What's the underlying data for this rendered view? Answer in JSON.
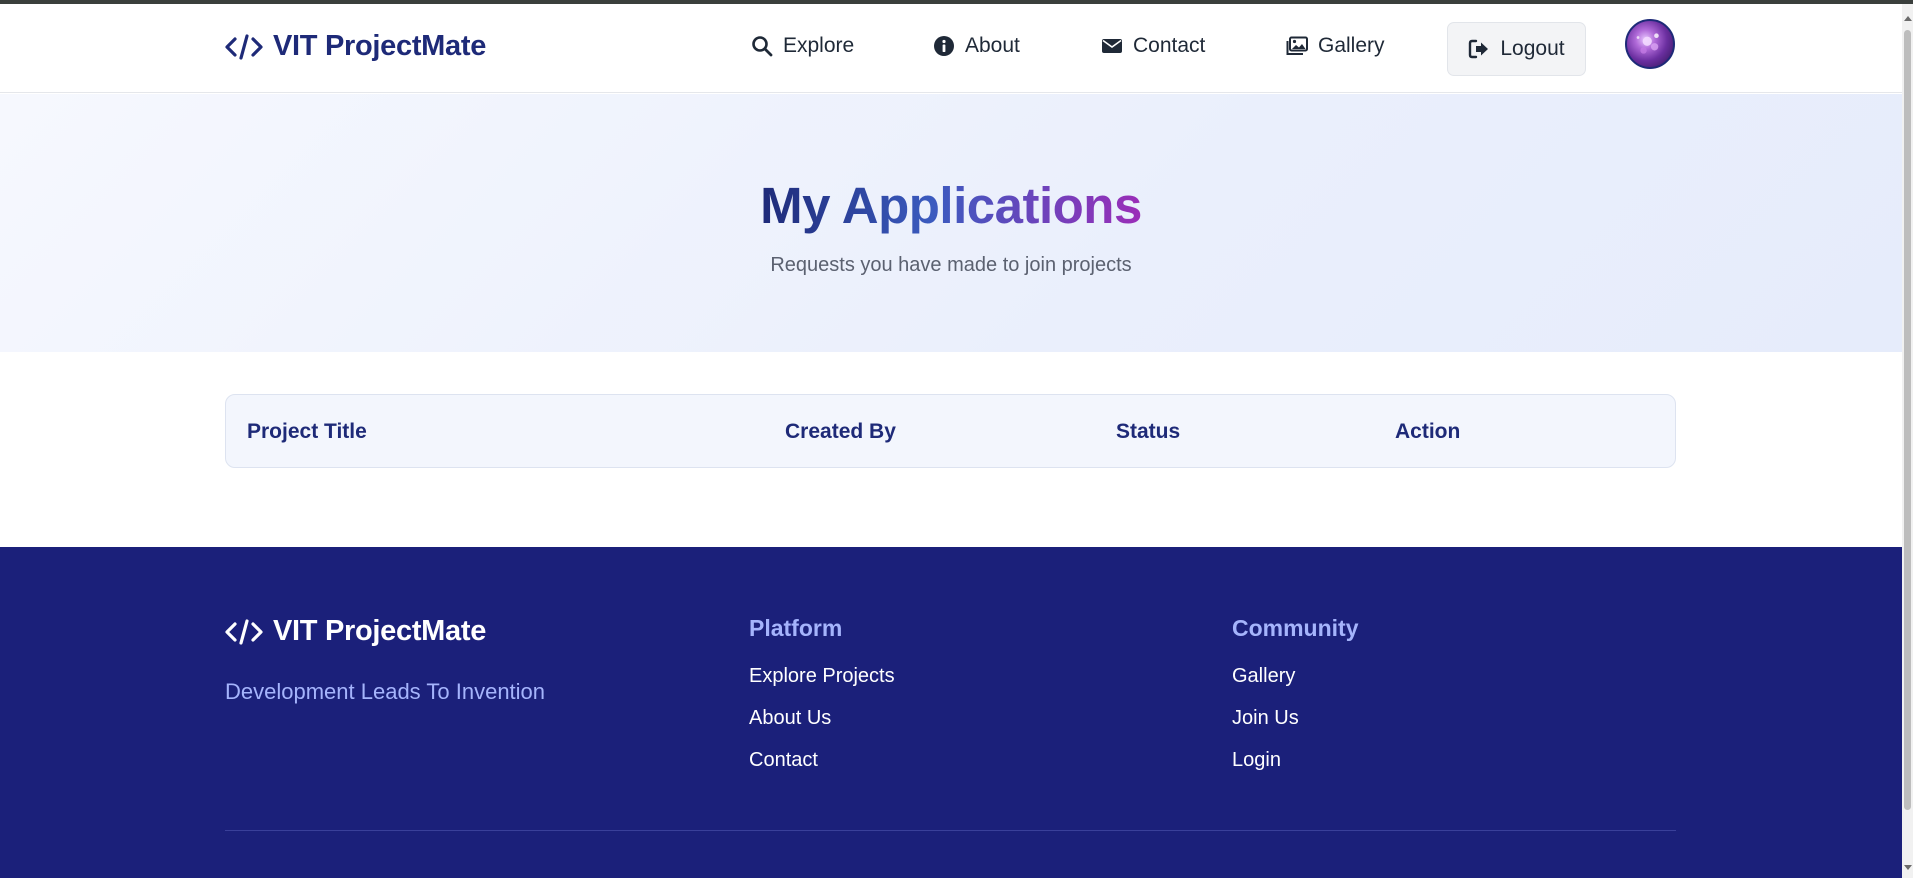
{
  "navbar": {
    "brand": "VIT ProjectMate",
    "links": [
      {
        "label": "Explore",
        "icon": "search-icon"
      },
      {
        "label": "About",
        "icon": "info-icon"
      },
      {
        "label": "Contact",
        "icon": "envelope-icon"
      },
      {
        "label": "Gallery",
        "icon": "images-icon"
      }
    ],
    "logout_label": "Logout"
  },
  "hero": {
    "title": "My Applications",
    "subtitle": "Requests you have made to join projects"
  },
  "table": {
    "columns": [
      "Project Title",
      "Created By",
      "Status",
      "Action"
    ],
    "rows": []
  },
  "footer": {
    "brand": "VIT ProjectMate",
    "tagline": "Development Leads To Invention",
    "columns": [
      {
        "heading": "Platform",
        "links": [
          "Explore Projects",
          "About Us",
          "Contact"
        ]
      },
      {
        "heading": "Community",
        "links": [
          "Gallery",
          "Join Us",
          "Login"
        ]
      }
    ]
  },
  "colors": {
    "brand": "#1e2a78",
    "footer_bg": "#1b207a",
    "accent": "#a5b4fc",
    "gradient_end": "#9b2db8"
  }
}
